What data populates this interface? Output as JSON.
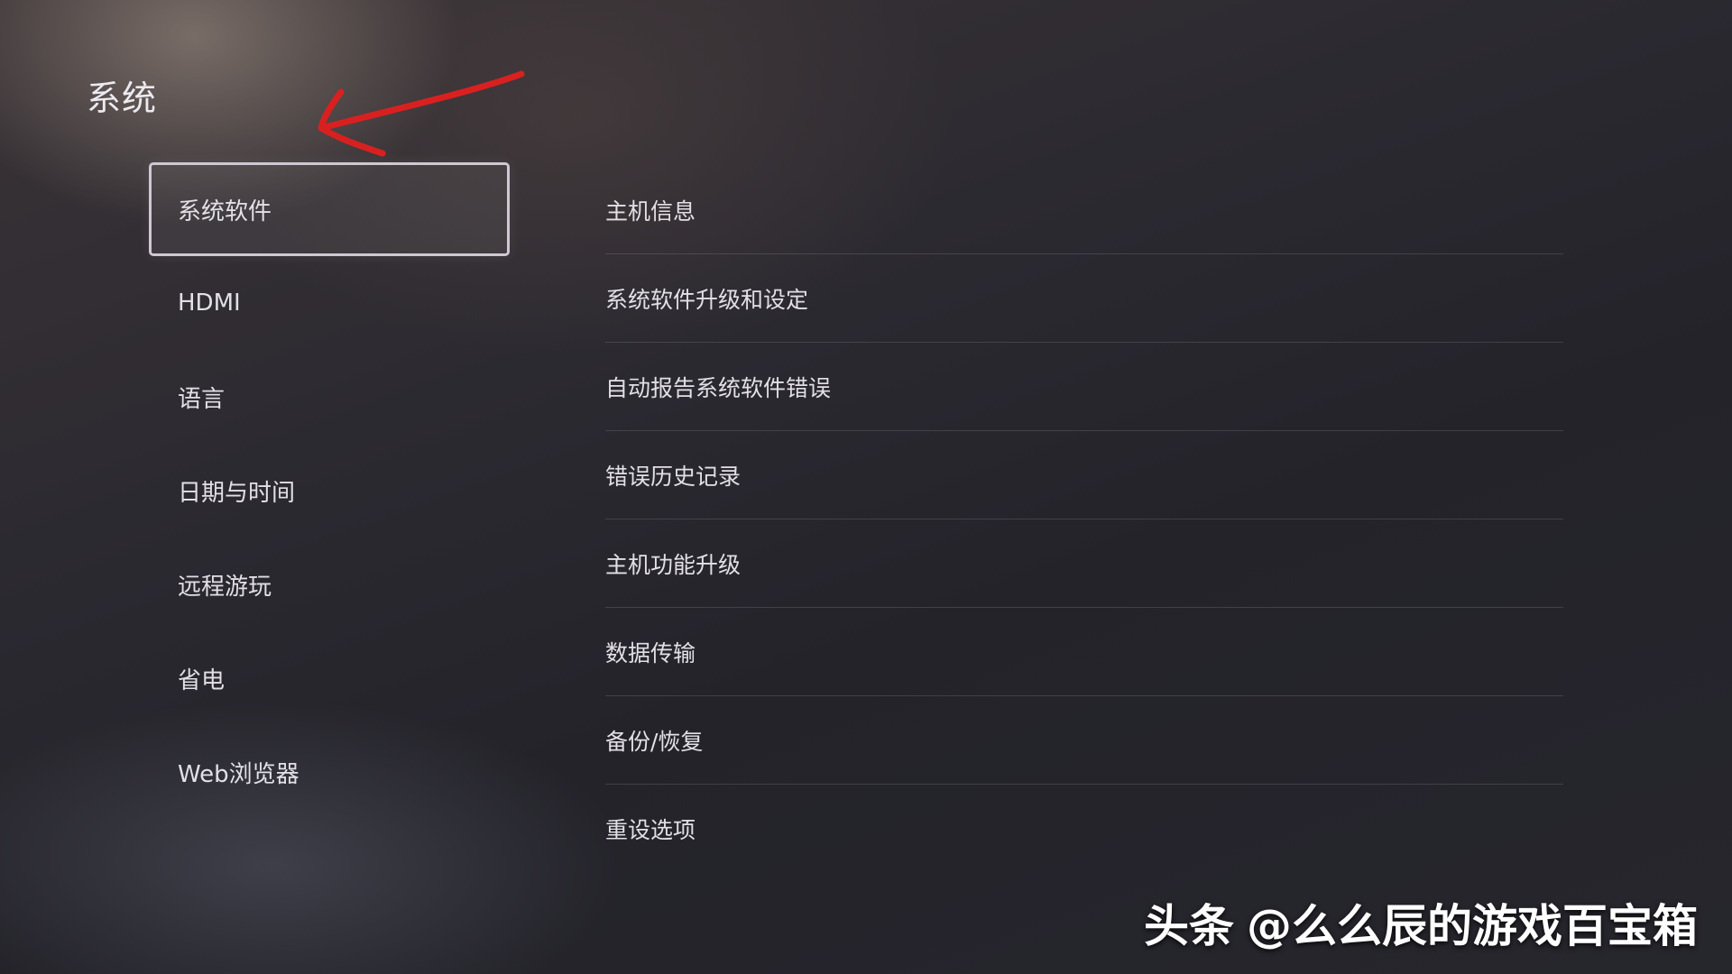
{
  "page": {
    "title": "系统"
  },
  "left_menu": {
    "items": [
      {
        "label": "系统软件",
        "selected": true
      },
      {
        "label": "HDMI"
      },
      {
        "label": "语言"
      },
      {
        "label": "日期与时间"
      },
      {
        "label": "远程游玩"
      },
      {
        "label": "省电"
      },
      {
        "label": "Web浏览器"
      }
    ]
  },
  "right_list": {
    "items": [
      {
        "label": "主机信息"
      },
      {
        "label": "系统软件升级和设定"
      },
      {
        "label": "自动报告系统软件错误"
      },
      {
        "label": "错误历史记录"
      },
      {
        "label": "主机功能升级"
      },
      {
        "label": "数据传输"
      },
      {
        "label": "备份/恢复"
      },
      {
        "label": "重设选项"
      }
    ]
  },
  "annotation": {
    "arrow_color": "#d92020",
    "icon": "red-arrow-icon"
  },
  "watermark": {
    "brand": "头条",
    "handle": "@么么辰的游戏百宝箱"
  },
  "colors": {
    "selection_border": "#cfc8d2",
    "text": "#e2e0e6"
  }
}
